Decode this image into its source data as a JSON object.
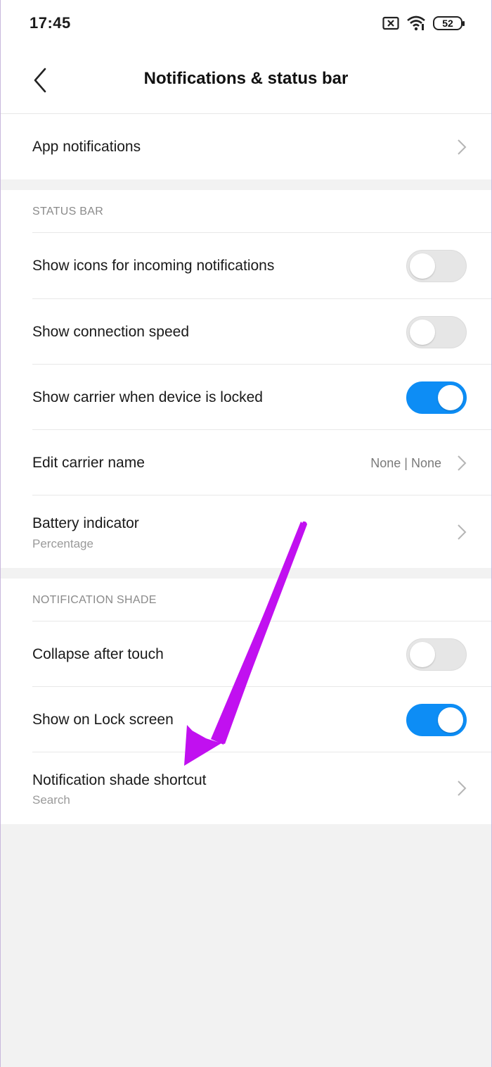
{
  "status_bar": {
    "time": "17:45",
    "battery": "52",
    "icons": [
      "sim-none-icon",
      "wifi-icon",
      "battery-icon"
    ]
  },
  "header": {
    "title": "Notifications & status bar",
    "back_icon": "back-chevron-icon"
  },
  "app_notifications": {
    "label": "App notifications"
  },
  "status_bar_section": {
    "heading": "STATUS BAR",
    "items": [
      {
        "label": "Show icons for incoming notifications",
        "type": "toggle",
        "on": false
      },
      {
        "label": "Show connection speed",
        "type": "toggle",
        "on": false
      },
      {
        "label": "Show carrier when device is locked",
        "type": "toggle",
        "on": true
      },
      {
        "label": "Edit carrier name",
        "type": "link",
        "value": "None | None"
      },
      {
        "label": "Battery indicator",
        "type": "link",
        "sublabel": "Percentage"
      }
    ]
  },
  "notification_shade_section": {
    "heading": "NOTIFICATION SHADE",
    "items": [
      {
        "label": "Collapse after touch",
        "type": "toggle",
        "on": false
      },
      {
        "label": "Show on Lock screen",
        "type": "toggle",
        "on": true
      },
      {
        "label": "Notification shade shortcut",
        "type": "link",
        "sublabel": "Search"
      }
    ]
  },
  "colors": {
    "toggle_on": "#0d8df5",
    "toggle_off": "#e6e6e6",
    "annotation_arrow": "#c110f0",
    "background": "#f2f2f2"
  }
}
